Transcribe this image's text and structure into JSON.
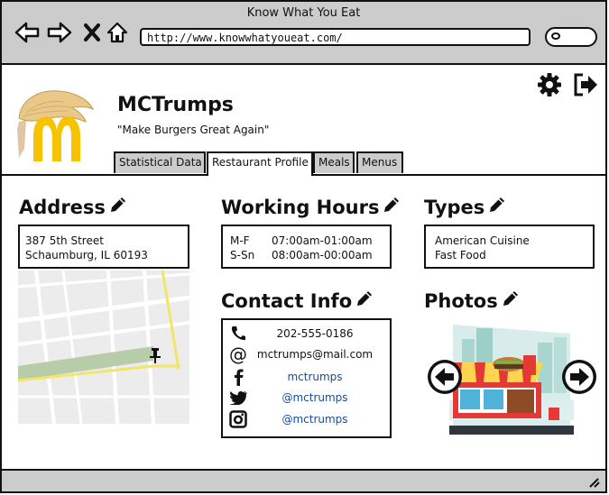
{
  "window": {
    "title": "Know What You Eat"
  },
  "nav": {
    "back_icon": "arrow-left-icon",
    "forward_icon": "arrow-right-icon",
    "stop_icon": "close-icon",
    "home_icon": "home-icon",
    "url": "http://www.knowwhatyoueat.com/",
    "search_icon": "search-icon"
  },
  "header": {
    "restaurant_name": "MCTrumps",
    "slogan": "\"Make Burgers Great Again\"",
    "settings_icon": "gear-icon",
    "logout_icon": "logout-icon"
  },
  "tabs": [
    {
      "label": "Statistical Data",
      "active": false
    },
    {
      "label": "Restaurant Profile",
      "active": true
    },
    {
      "label": "Meals",
      "active": false
    },
    {
      "label": "Menus",
      "active": false
    }
  ],
  "address": {
    "title": "Address",
    "lines": [
      "387 5th Street",
      "Schaumburg, IL 60193"
    ]
  },
  "working_hours": {
    "title": "Working Hours",
    "rows": [
      {
        "days": "M-F",
        "hours": "07:00am-01:00am"
      },
      {
        "days": "S-Sn",
        "hours": "08:00am-00:00am"
      }
    ]
  },
  "types": {
    "title": "Types",
    "items": [
      "American Cuisine",
      "Fast Food"
    ]
  },
  "contact": {
    "title": "Contact Info",
    "phone": "202-555-0186",
    "email": "mctrumps@mail.com",
    "facebook": "mctrumps",
    "twitter": "@mctrumps",
    "instagram": "@mctrumps"
  },
  "photos": {
    "title": "Photos"
  }
}
